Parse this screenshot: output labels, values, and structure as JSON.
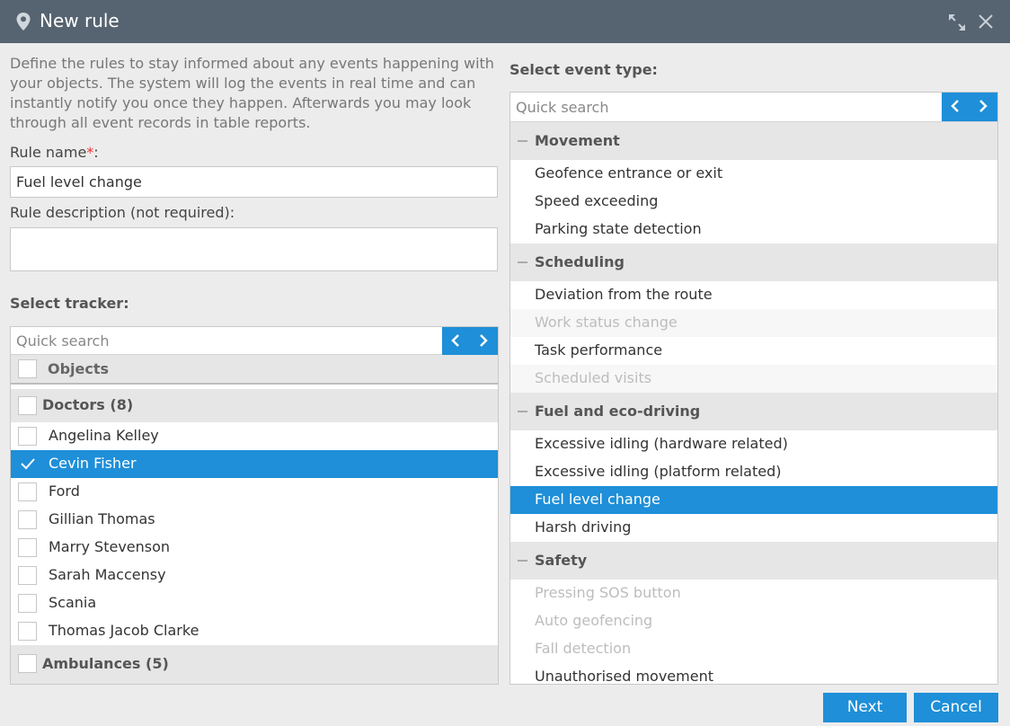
{
  "window": {
    "title": "New rule"
  },
  "intro": "Define the rules to stay informed about any events happening with your objects. The system will log the events in real time and can instantly notify you once they happen. Afterwards you may look through all event records in table reports.",
  "form": {
    "rule_name_label": "Rule name",
    "required_mark": "*",
    "rule_name_colon": ":",
    "rule_name_value": "Fuel level change",
    "rule_desc_label": "Rule description (not required):",
    "rule_desc_value": ""
  },
  "tracker": {
    "heading": "Select tracker:",
    "search_placeholder": "Quick search",
    "objects_label": "Objects",
    "groups": [
      {
        "label": "Doctors (8)",
        "items": [
          "Angelina Kelley",
          "Cevin Fisher",
          "Ford",
          "Gillian Thomas",
          "Marry Stevenson",
          "Sarah Maccensy",
          "Scania",
          "Thomas Jacob Clarke"
        ],
        "selected": "Cevin Fisher"
      },
      {
        "label": "Ambulances (5)",
        "items": []
      }
    ]
  },
  "events": {
    "heading": "Select event type:",
    "search_placeholder": "Quick search",
    "groups": [
      {
        "label": "Movement",
        "items": [
          {
            "label": "Geofence entrance or exit",
            "state": "normal"
          },
          {
            "label": "Speed exceeding",
            "state": "normal"
          },
          {
            "label": "Parking state detection",
            "state": "normal"
          }
        ]
      },
      {
        "label": "Scheduling",
        "items": [
          {
            "label": "Deviation from the route",
            "state": "normal"
          },
          {
            "label": "Work status change",
            "state": "disabled"
          },
          {
            "label": "Task performance",
            "state": "normal"
          },
          {
            "label": "Scheduled visits",
            "state": "disabled"
          }
        ]
      },
      {
        "label": "Fuel and eco-driving",
        "items": [
          {
            "label": "Excessive idling (hardware related)",
            "state": "normal"
          },
          {
            "label": "Excessive idling (platform related)",
            "state": "normal"
          },
          {
            "label": "Fuel level change",
            "state": "selected"
          },
          {
            "label": "Harsh driving",
            "state": "normal"
          }
        ]
      },
      {
        "label": "Safety",
        "items": [
          {
            "label": "Pressing SOS button",
            "state": "disabled"
          },
          {
            "label": "Auto geofencing",
            "state": "disabled"
          },
          {
            "label": "Fall detection",
            "state": "disabled"
          },
          {
            "label": "Unauthorised movement",
            "state": "normal"
          }
        ]
      }
    ]
  },
  "buttons": {
    "next": "Next",
    "cancel": "Cancel"
  },
  "colors": {
    "accent": "#1e8fd8",
    "titlebar": "#566370",
    "required": "#e33333",
    "disabled_text": "#bdbdbd"
  }
}
